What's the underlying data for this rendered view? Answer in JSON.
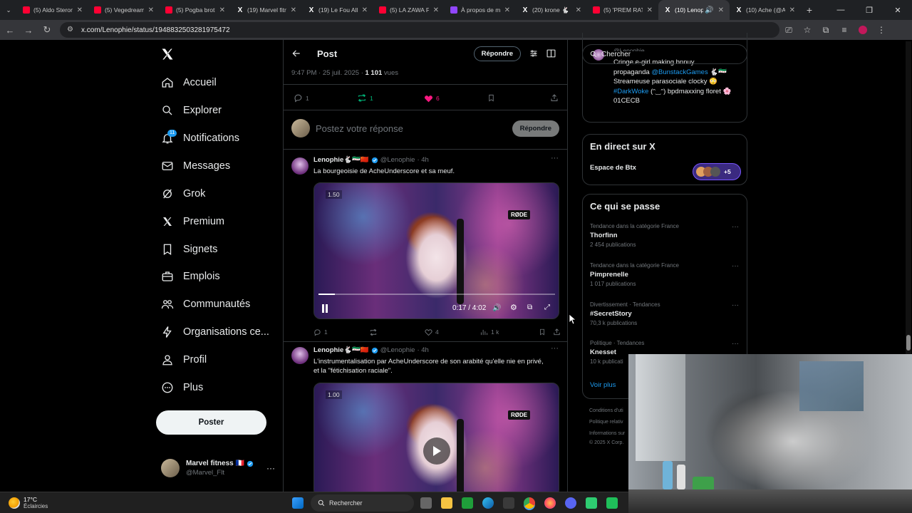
{
  "browser": {
    "tabs": [
      {
        "title": "(5) Aldo Steron",
        "favicon": "youtube"
      },
      {
        "title": "(5) Vegedream",
        "favicon": "youtube"
      },
      {
        "title": "(5) Pogba broth",
        "favicon": "youtube"
      },
      {
        "title": "(19) Marvel fitn",
        "favicon": "x"
      },
      {
        "title": "(19) Le Fou Alli",
        "favicon": "x"
      },
      {
        "title": "(5) LA ZAWA F",
        "favicon": "youtube"
      },
      {
        "title": "À propos de m",
        "favicon": "twitch"
      },
      {
        "title": "(20) krone 🐇",
        "favicon": "x"
      },
      {
        "title": "(5) 'PREM RAT",
        "favicon": "youtube"
      },
      {
        "title": "(10) Lenop",
        "favicon": "x",
        "active": true
      },
      {
        "title": "(10) Ache (@A",
        "favicon": "x"
      }
    ],
    "new_tab": "+",
    "url": "x.com/Lenophie/status/1948832503281975472"
  },
  "nav": {
    "items": [
      {
        "label": "Accueil",
        "icon": "home-icon"
      },
      {
        "label": "Explorer",
        "icon": "search-icon"
      },
      {
        "label": "Notifications",
        "icon": "bell-icon",
        "badge": "11"
      },
      {
        "label": "Messages",
        "icon": "mail-icon"
      },
      {
        "label": "Grok",
        "icon": "grok-icon"
      },
      {
        "label": "Premium",
        "icon": "x-icon"
      },
      {
        "label": "Signets",
        "icon": "bookmark-icon"
      },
      {
        "label": "Emplois",
        "icon": "briefcase-icon"
      },
      {
        "label": "Communautés",
        "icon": "people-icon"
      },
      {
        "label": "Organisations ce...",
        "icon": "lightning-icon"
      },
      {
        "label": "Profil",
        "icon": "person-icon"
      },
      {
        "label": "Plus",
        "icon": "more-circle-icon"
      }
    ],
    "post_button": "Poster",
    "account": {
      "name": "Marvel fitness 🇫🇷",
      "handle": "@Marvel_Flt",
      "more": "···"
    }
  },
  "main": {
    "header": {
      "title": "Post",
      "reply_button": "Répondre"
    },
    "post_meta": {
      "time": "9:47 PM · 25 juil. 2025 · ",
      "views": "1 101",
      "views_label": " vues"
    },
    "post_actions": {
      "replies": "1",
      "reposts": "1",
      "likes": "6"
    },
    "reply_box": {
      "placeholder": "Postez votre réponse",
      "button": "Répondre"
    },
    "replies": [
      {
        "name": "Lenophie🐇🇸🇾🇨🇳",
        "handle": "@Lenophie",
        "time": "· 4h",
        "text": "La bourgeoisie de AcheUnderscore et sa meuf.",
        "video": {
          "speed": "1.50",
          "time": "0:17 / 4:02",
          "playing": true,
          "progress": 0.07,
          "mic_label": "RØDE"
        },
        "actions": {
          "replies": "1",
          "reposts": "",
          "likes": "4",
          "views": "1 k"
        }
      },
      {
        "name": "Lenophie🐇🇸🇾🇨🇳",
        "handle": "@Lenophie",
        "time": "· 4h",
        "text": "L'instrumentalisation par AcheUnderscore de son arabité qu'elle nie en privé, et la \"fétichisation raciale\".",
        "video": {
          "speed": "1.00",
          "playing": false,
          "mic_label": "RØDE"
        }
      }
    ]
  },
  "right": {
    "search_placeholder": "Chercher",
    "profile_snippet": {
      "handle": "@Lenophie",
      "bio_line1": "Cringe e-girl making bnnuy",
      "bio_line2_pre": "propaganda ",
      "bio_mention": "@BunstackGames",
      "bio_line2_post": " 🐇🇸🇾",
      "bio_line3": "Streameuse parasociale clocky 😳",
      "bio_hashtag": "#DarkWoke",
      "bio_line4_post": " (ᵔ‿ᵔ) bpdmaxxing floret 🌸",
      "bio_line5": "01CECB"
    },
    "live": {
      "title": "En direct sur X",
      "space": "Espace de Btx",
      "more": "+5"
    },
    "trends": {
      "title": "Ce qui se passe",
      "items": [
        {
          "category": "Tendance dans la catégorie France",
          "name": "Thorfinn",
          "count": "2 454 publications"
        },
        {
          "category": "Tendance dans la catégorie France",
          "name": "Pimprenelle",
          "count": "1 017 publications"
        },
        {
          "category": "Divertissement · Tendances",
          "name": "#SecretStory",
          "count": "70,3 k publications"
        },
        {
          "category": "Politique · Tendances",
          "name": "Knesset",
          "count": "10 k publicati"
        }
      ],
      "more": "Voir plus"
    },
    "footer": [
      "Conditions d'uti",
      "Politique relativ",
      "Informations sur",
      "© 2025 X Corp."
    ]
  },
  "taskbar": {
    "weather_temp": "17°C",
    "weather_desc": "Éclaircies",
    "search": "Rechercher"
  },
  "colors": {
    "accent": "#1d9bf0",
    "like": "#f91880",
    "repost": "#00ba7c",
    "background": "#000000",
    "border": "#2f3336"
  }
}
